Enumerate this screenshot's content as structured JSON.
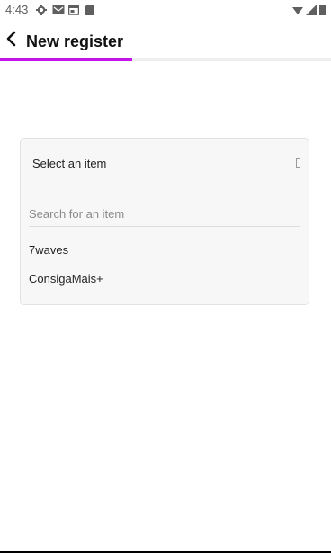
{
  "status_bar": {
    "time": "4:43",
    "icons": [
      "gear-icon",
      "mail-icon",
      "calendar-icon",
      "sdcard-icon"
    ],
    "right_icons": [
      "wifi-icon",
      "signal-icon",
      "battery-icon"
    ]
  },
  "appbar": {
    "title": "New register",
    "progress": 0.4
  },
  "dropdown": {
    "label": "Select an item",
    "search_placeholder": "Search for an item",
    "options": [
      "7waves",
      "ConsigaMais+"
    ]
  },
  "colors": {
    "accent": "#c415e8"
  }
}
